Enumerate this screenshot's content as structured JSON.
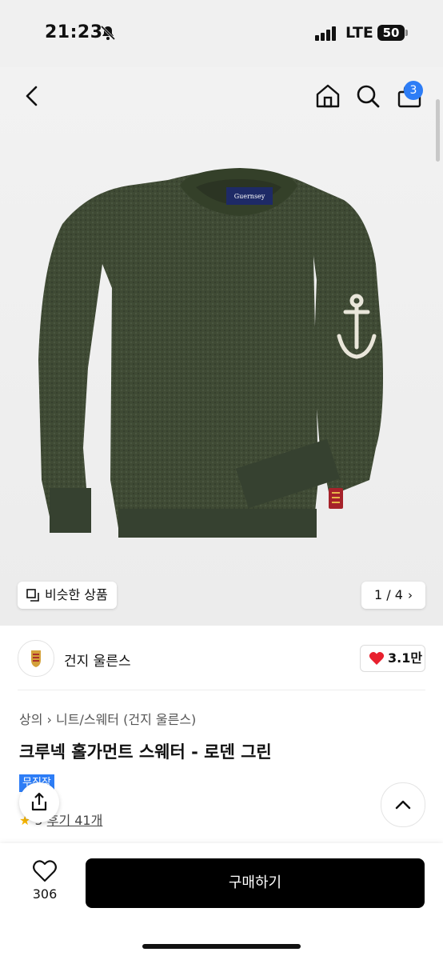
{
  "status": {
    "time": "21:23",
    "network": "LTE",
    "battery": "50"
  },
  "nav": {
    "cart_count": "3"
  },
  "image_controls": {
    "similar_label": "비슷한 상품",
    "pager": "1 / 4"
  },
  "brand": {
    "name": "건지 울른스",
    "likes": "3.1만"
  },
  "product": {
    "breadcrumb_parent": "상의",
    "breadcrumb_child": "니트/스웨터 (건지 울른스)",
    "title": "크루넥 홀가먼트 스웨터 - 로덴 그린",
    "badge": "무진장",
    "rating_partial": "5",
    "reviews": "후기 41개"
  },
  "bottom": {
    "wish_count": "306",
    "buy_label": "구매하기"
  },
  "colors": {
    "accent": "#2d7df6",
    "heart": "#e8202e",
    "sweater": "#3e4a33"
  }
}
